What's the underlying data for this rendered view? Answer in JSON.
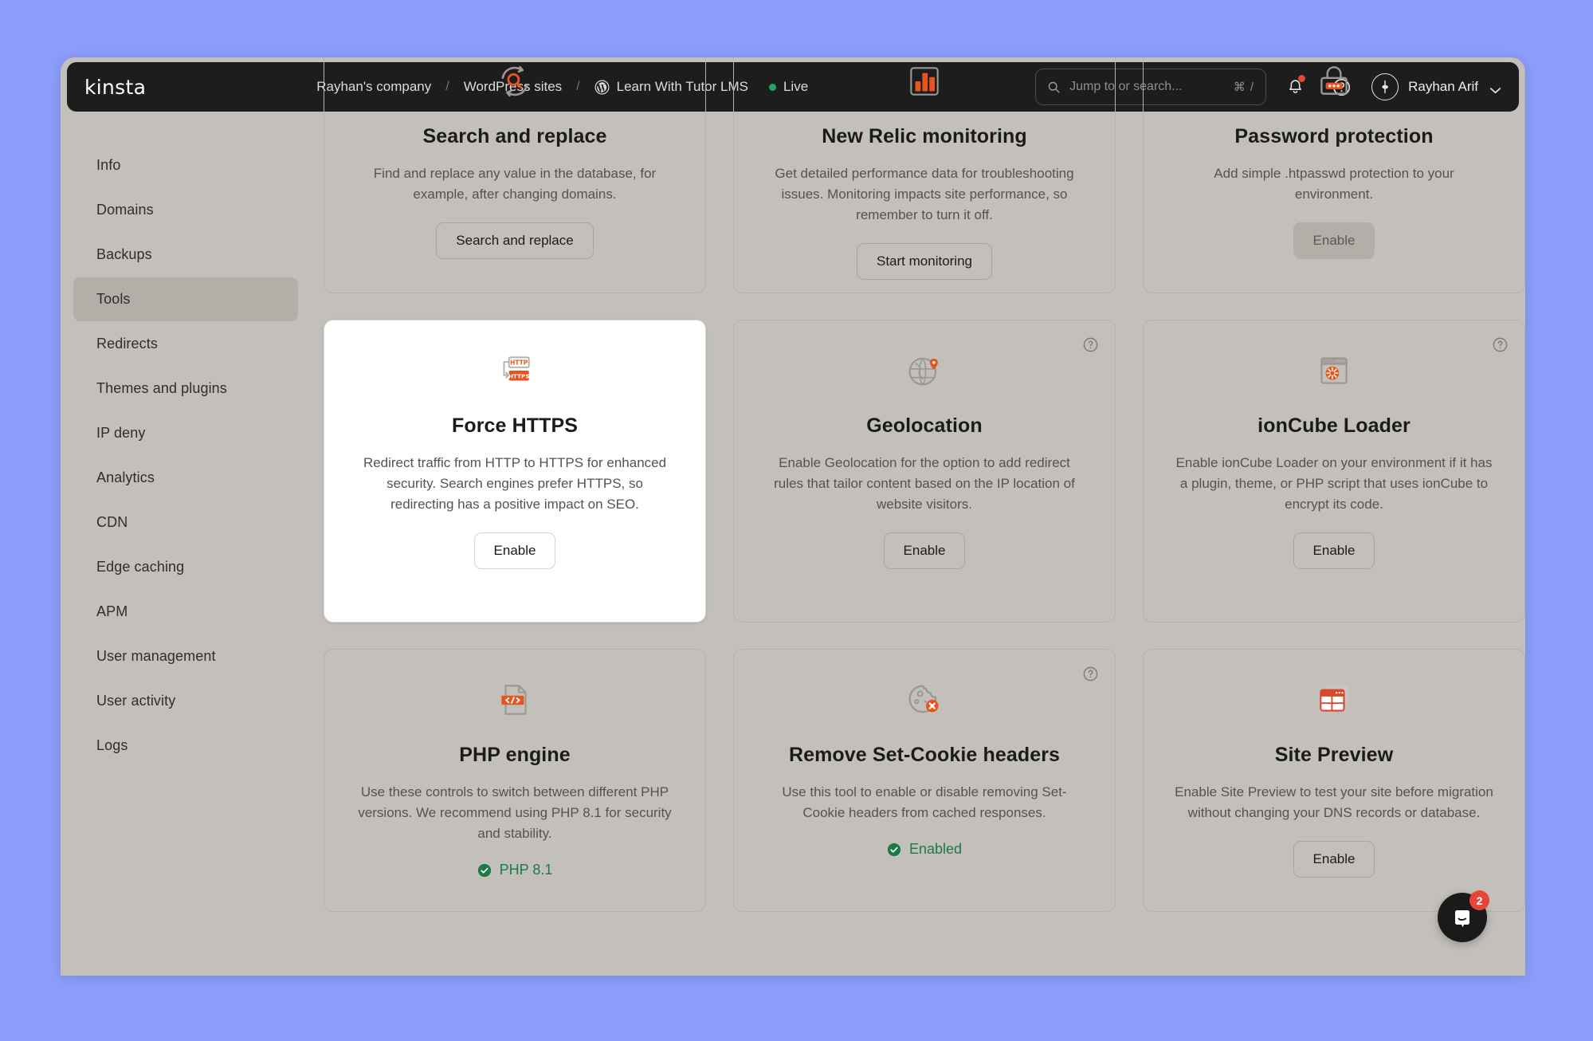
{
  "header": {
    "logo": "kinsta",
    "breadcrumbs": [
      {
        "label": "Rayhan's company",
        "icon": null
      },
      {
        "label": "WordPress sites",
        "icon": null
      },
      {
        "label": "Learn With Tutor LMS",
        "icon": "wordpress-icon"
      }
    ],
    "separator": "/",
    "status": "Live",
    "status_color": "#23a566",
    "search": {
      "placeholder": "Jump to or search...",
      "value": "",
      "shortcut": "⌘ /"
    },
    "notifications_badge": true,
    "user": {
      "name": "Rayhan Arif"
    }
  },
  "sidebar": {
    "items": [
      {
        "label": "Info",
        "active": false
      },
      {
        "label": "Domains",
        "active": false
      },
      {
        "label": "Backups",
        "active": false
      },
      {
        "label": "Tools",
        "active": true
      },
      {
        "label": "Redirects",
        "active": false
      },
      {
        "label": "Themes and plugins",
        "active": false
      },
      {
        "label": "IP deny",
        "active": false
      },
      {
        "label": "Analytics",
        "active": false
      },
      {
        "label": "CDN",
        "active": false
      },
      {
        "label": "Edge caching",
        "active": false
      },
      {
        "label": "APM",
        "active": false
      },
      {
        "label": "User management",
        "active": false
      },
      {
        "label": "User activity",
        "active": false
      },
      {
        "label": "Logs",
        "active": false
      }
    ]
  },
  "cards": [
    {
      "id": "search-and-replace",
      "icon": "search-replace-icon",
      "title": "Search and replace",
      "description": "Find and replace any value in the database, for example, after changing domains.",
      "button": "Search and replace",
      "button_style": "outline",
      "help": false,
      "focused": false
    },
    {
      "id": "new-relic-monitoring",
      "icon": "bar-chart-icon",
      "title": "New Relic monitoring",
      "description": "Get detailed performance data for troubleshooting issues. Monitoring impacts site performance, so remember to turn it off.",
      "button": "Start monitoring",
      "button_style": "outline",
      "help": false,
      "focused": false
    },
    {
      "id": "password-protection",
      "icon": "padlock-icon",
      "title": "Password protection",
      "description": "Add simple .htpasswd protection to your environment.",
      "button": "Enable",
      "button_style": "filled",
      "help": false,
      "focused": false
    },
    {
      "id": "force-https",
      "icon": "http-to-https-icon",
      "title": "Force HTTPS",
      "description": "Redirect traffic from HTTP to HTTPS for enhanced security. Search engines prefer HTTPS, so redirecting has a positive impact on SEO.",
      "button": "Enable",
      "button_style": "outline",
      "help": false,
      "focused": true
    },
    {
      "id": "geolocation",
      "icon": "globe-pin-icon",
      "title": "Geolocation",
      "description": "Enable Geolocation for the option to add redirect rules that tailor content based on the IP location of website visitors.",
      "button": "Enable",
      "button_style": "outline",
      "help": true,
      "focused": false
    },
    {
      "id": "ioncube-loader",
      "icon": "browser-spinner-icon",
      "title": "ionCube Loader",
      "description": "Enable ionCube Loader on your environment if it has a plugin, theme, or PHP script that uses ionCube to encrypt its code.",
      "button": "Enable",
      "button_style": "outline",
      "help": true,
      "focused": false
    },
    {
      "id": "php-engine",
      "icon": "code-file-icon",
      "title": "PHP engine",
      "description": "Use these controls to switch between different PHP versions. We recommend using PHP 8.1 for security and stability.",
      "status": "PHP 8.1",
      "help": false,
      "focused": false
    },
    {
      "id": "remove-set-cookie-headers",
      "icon": "cookie-block-icon",
      "title": "Remove Set-Cookie headers",
      "description": "Use this tool to enable or disable removing Set-Cookie headers from cached responses.",
      "status": "Enabled",
      "help": true,
      "focused": false
    },
    {
      "id": "site-preview",
      "icon": "site-preview-icon",
      "title": "Site Preview",
      "description": "Enable Site Preview to test your site before migration without changing your DNS records or database.",
      "button": "Enable",
      "button_style": "outline",
      "help": false,
      "focused": false
    }
  ],
  "intercom": {
    "badge": "2"
  },
  "colors": {
    "accent": "#e8541f",
    "success": "#1c7a46",
    "danger": "#e8443a",
    "page_bg": "#8b9df9"
  }
}
